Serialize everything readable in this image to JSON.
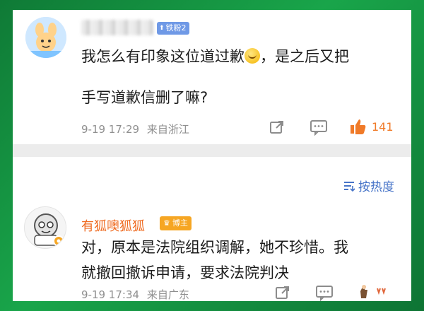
{
  "comments": [
    {
      "fan_badge": "铁粉2",
      "text_line1": "我怎么有印象这位道过歉",
      "text_line1_tail": "，是之后又把",
      "text_line2": "手写道歉信删了嘛?",
      "time": "9-19 17:29",
      "location": "来自浙江",
      "likes": "141"
    },
    {
      "username": "有狐噢狐狐",
      "owner_badge": "博主",
      "text_line1": "对，原本是法院组织调解，她不珍惜。我",
      "text_line2": "就撤回撤诉申请，要求法院判决",
      "time": "9-19 17:34",
      "location": "来自广东"
    }
  ],
  "sort_label": "按热度",
  "colors": {
    "accent": "#ef6b21",
    "like": "#f07a28",
    "link": "#4774c8",
    "background": "#19a54a"
  },
  "icons": [
    "share-icon",
    "comment-icon",
    "like-icon",
    "sort-icon",
    "emoji-icon",
    "avatar-icon"
  ]
}
